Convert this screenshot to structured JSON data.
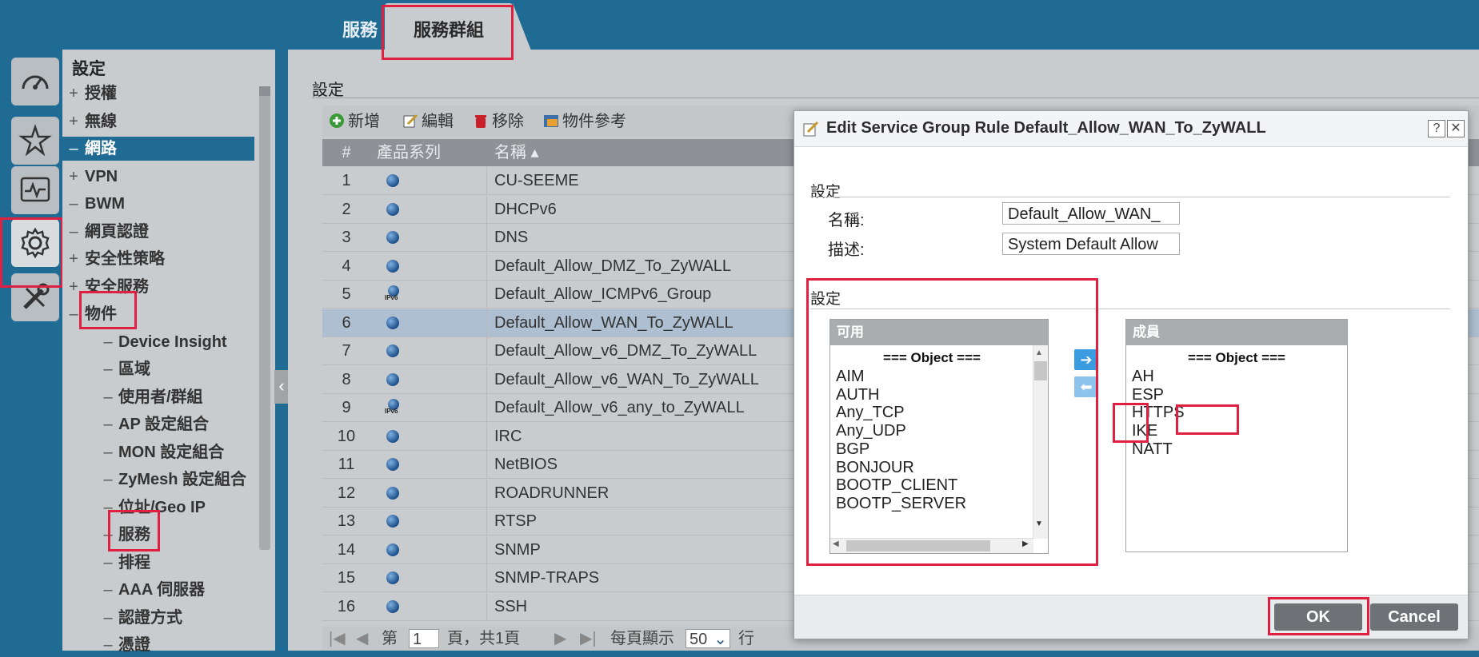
{
  "tabs": [
    {
      "label": "服務",
      "active": false
    },
    {
      "label": "服務群組",
      "active": true
    }
  ],
  "nav": {
    "title": "設定",
    "items": [
      {
        "sym": "+",
        "label": "授權",
        "level": 0
      },
      {
        "sym": "+",
        "label": "無線",
        "level": 0
      },
      {
        "sym": "–",
        "label": "網路",
        "level": 0,
        "selected": true
      },
      {
        "sym": "+",
        "label": "VPN",
        "level": 0
      },
      {
        "sym": "–",
        "label": "BWM",
        "level": 0
      },
      {
        "sym": "–",
        "label": "網頁認證",
        "level": 0
      },
      {
        "sym": "+",
        "label": "安全性策略",
        "level": 0
      },
      {
        "sym": "+",
        "label": "安全服務",
        "level": 0
      },
      {
        "sym": "–",
        "label": "物件",
        "level": 0
      },
      {
        "sym": "–",
        "label": "Device Insight",
        "level": 1
      },
      {
        "sym": "–",
        "label": "區域",
        "level": 1
      },
      {
        "sym": "–",
        "label": "使用者/群組",
        "level": 1
      },
      {
        "sym": "–",
        "label": "AP 設定組合",
        "level": 1
      },
      {
        "sym": "–",
        "label": "MON 設定組合",
        "level": 1
      },
      {
        "sym": "–",
        "label": "ZyMesh 設定組合",
        "level": 1
      },
      {
        "sym": "–",
        "label": "位址/Geo IP",
        "level": 1
      },
      {
        "sym": "–",
        "label": "服務",
        "level": 1
      },
      {
        "sym": "–",
        "label": "排程",
        "level": 1
      },
      {
        "sym": "–",
        "label": "AAA 伺服器",
        "level": 1
      },
      {
        "sym": "–",
        "label": "認證方式",
        "level": 1
      },
      {
        "sym": "–",
        "label": "憑證",
        "level": 1
      }
    ]
  },
  "main": {
    "section_title": "設定",
    "toolbar": {
      "add": "新增",
      "edit": "編輯",
      "remove": "移除",
      "reference": "物件參考"
    },
    "columns": {
      "num": "#",
      "family": "產品系列",
      "name": "名稱 ▴"
    },
    "rows": [
      {
        "num": "1",
        "icon": "globe",
        "name": "CU-SEEME"
      },
      {
        "num": "2",
        "icon": "globe",
        "name": "DHCPv6"
      },
      {
        "num": "3",
        "icon": "globe",
        "name": "DNS"
      },
      {
        "num": "4",
        "icon": "globe",
        "name": "Default_Allow_DMZ_To_ZyWALL"
      },
      {
        "num": "5",
        "icon": "ipv6",
        "name": "Default_Allow_ICMPv6_Group"
      },
      {
        "num": "6",
        "icon": "globe",
        "name": "Default_Allow_WAN_To_ZyWALL",
        "selected": true
      },
      {
        "num": "7",
        "icon": "globe",
        "name": "Default_Allow_v6_DMZ_To_ZyWALL"
      },
      {
        "num": "8",
        "icon": "globe",
        "name": "Default_Allow_v6_WAN_To_ZyWALL"
      },
      {
        "num": "9",
        "icon": "ipv6",
        "name": "Default_Allow_v6_any_to_ZyWALL"
      },
      {
        "num": "10",
        "icon": "globe",
        "name": "IRC"
      },
      {
        "num": "11",
        "icon": "globe",
        "name": "NetBIOS"
      },
      {
        "num": "12",
        "icon": "globe",
        "name": "ROADRUNNER"
      },
      {
        "num": "13",
        "icon": "globe",
        "name": "RTSP"
      },
      {
        "num": "14",
        "icon": "globe",
        "name": "SNMP"
      },
      {
        "num": "15",
        "icon": "globe",
        "name": "SNMP-TRAPS"
      },
      {
        "num": "16",
        "icon": "globe",
        "name": "SSH"
      }
    ],
    "pager": {
      "page_label": "第",
      "page_value": "1",
      "page_suffix": "頁，共1頁",
      "per_page_label": "每頁顯示",
      "per_page_value": "50",
      "rows_label": "行"
    },
    "ipv6_icon_text": "IPv6"
  },
  "dialog": {
    "title": "Edit Service Group Rule Default_Allow_WAN_To_ZyWALL",
    "help": "?",
    "close": "✕",
    "section1": "設定",
    "name_label": "名稱:",
    "name_value": "Default_Allow_WAN_",
    "desc_label": "描述:",
    "desc_value": "System Default Allow",
    "section2": "設定",
    "available": {
      "header": "可用",
      "caption": "=== Object ===",
      "items": [
        "AIM",
        "AUTH",
        "Any_TCP",
        "Any_UDP",
        "BGP",
        "BONJOUR",
        "BOOTP_CLIENT",
        "BOOTP_SERVER"
      ]
    },
    "members": {
      "header": "成員",
      "caption": "=== Object ===",
      "items": [
        "AH",
        "ESP",
        "HTTPS",
        "IKE",
        "NATT"
      ]
    },
    "add_arrow": "➔",
    "remove_arrow": "⬅",
    "ok": "OK",
    "cancel": "Cancel"
  },
  "colors": {
    "frame": "#1f6b94",
    "panel": "#c9ccce",
    "highlight": "#e02040",
    "arrow": "#3a9be0"
  }
}
